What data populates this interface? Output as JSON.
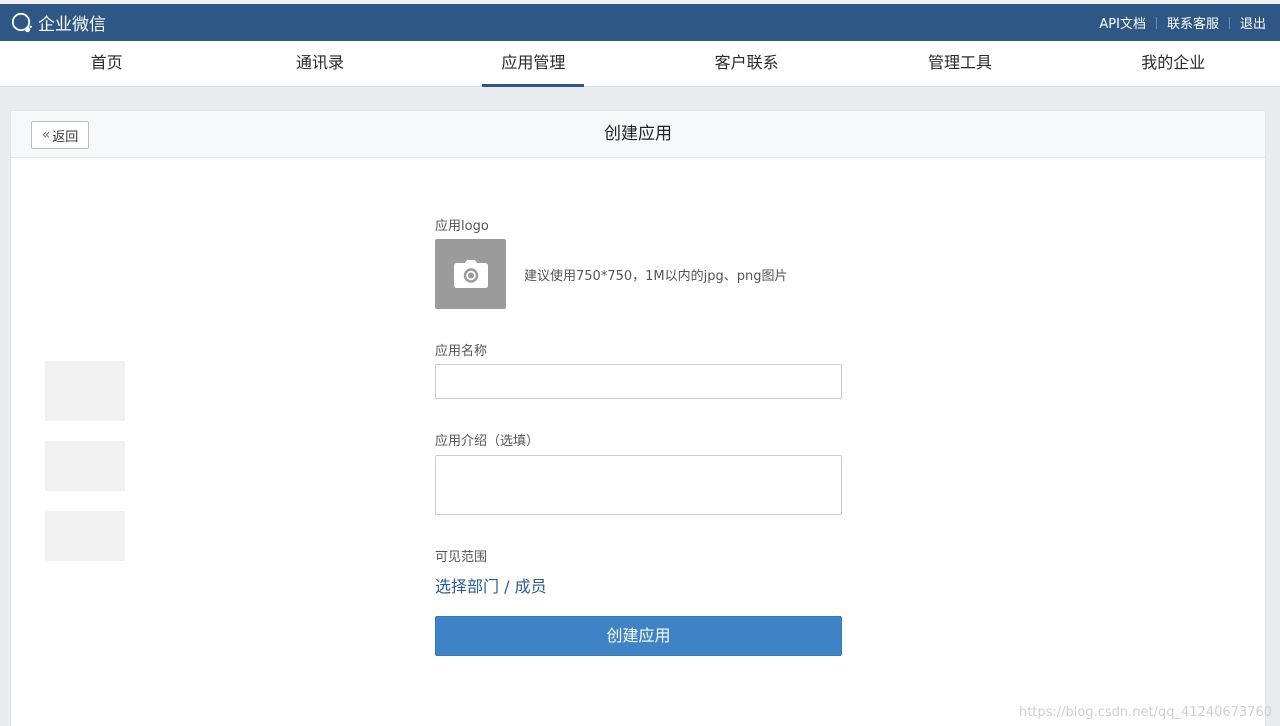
{
  "header": {
    "logo_text": "企业微信",
    "links": [
      "API文档",
      "联系客服",
      "退出"
    ]
  },
  "nav": {
    "items": [
      "首页",
      "通讯录",
      "应用管理",
      "客户联系",
      "管理工具",
      "我的企业"
    ],
    "active_index": 2
  },
  "panel": {
    "back_label": "返回",
    "title": "创建应用"
  },
  "form": {
    "logo_label": "应用logo",
    "logo_hint": "建议使用750*750，1M以内的jpg、png图片",
    "name_label": "应用名称",
    "name_value": "",
    "desc_label": "应用介绍（选填）",
    "desc_value": "",
    "visibility_label": "可见范围",
    "visibility_link": "选择部门 / 成员",
    "submit_label": "创建应用"
  },
  "watermark": "https://blog.csdn.net/qq_41240673760",
  "colors": {
    "header_bg": "#2f5786",
    "primary_button": "#3e83c6",
    "link": "#2a5c97"
  }
}
